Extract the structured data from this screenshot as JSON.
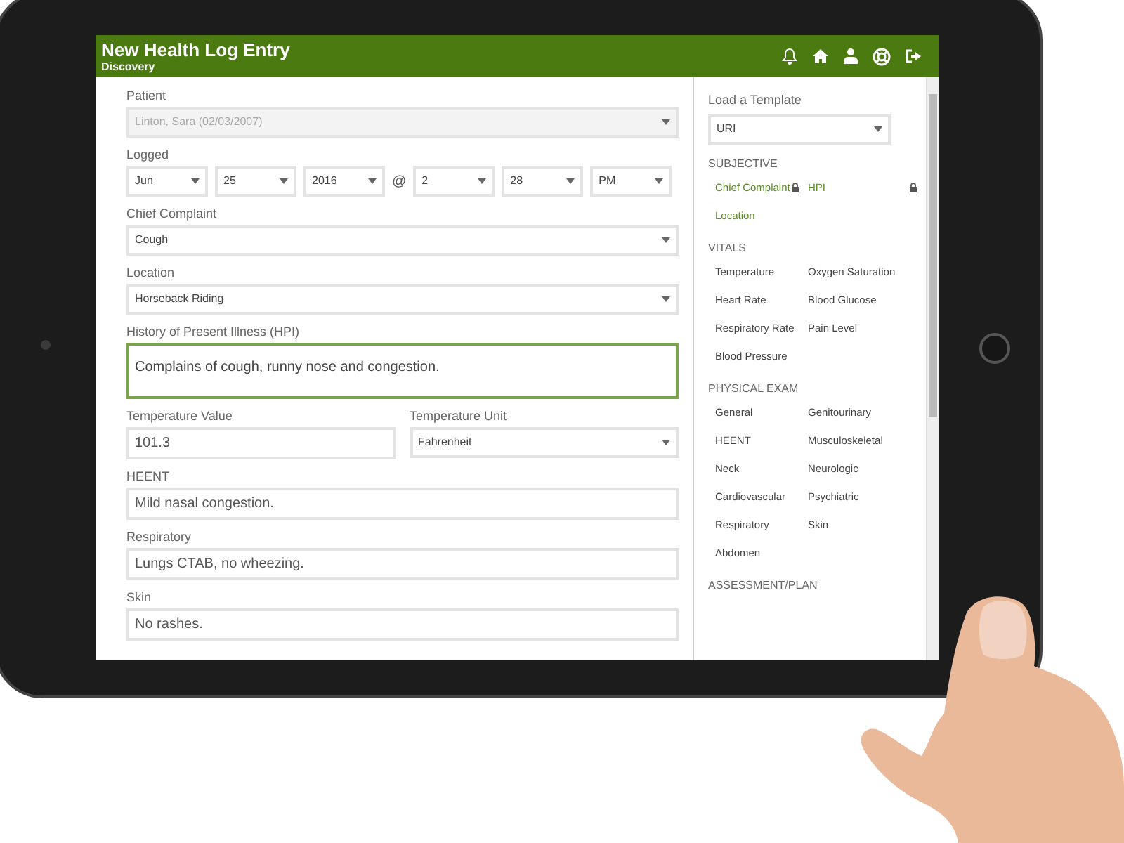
{
  "window": {
    "title": "New Health Log Entry",
    "subtitle": "Discovery"
  },
  "form": {
    "rows": [
      {
        "kind": "single",
        "fields": [
          {
            "label": "Patient",
            "kind": "select",
            "value": "Linton, Sara (02/03/2007)",
            "disabled": true,
            "focused": false
          }
        ]
      },
      {
        "kind": "datetime",
        "label": "Logged",
        "separator": "@",
        "parts": [
          {
            "value": "Jun"
          },
          {
            "value": "25"
          },
          {
            "value": "2016"
          },
          {
            "value": "2"
          },
          {
            "value": "28"
          },
          {
            "value": "PM"
          }
        ]
      },
      {
        "kind": "single",
        "fields": [
          {
            "label": "Chief Complaint",
            "kind": "select",
            "value": "Cough",
            "disabled": false,
            "focused": false
          }
        ]
      },
      {
        "kind": "single",
        "fields": [
          {
            "label": "Location",
            "kind": "select",
            "value": "Horseback Riding",
            "disabled": false,
            "focused": false
          }
        ]
      },
      {
        "kind": "single",
        "fields": [
          {
            "label": "History of Present Illness (HPI)",
            "kind": "textarea",
            "value": "Complains of cough, runny nose and congestion.",
            "disabled": false,
            "focused": true
          }
        ]
      },
      {
        "kind": "single",
        "fields": [
          {
            "label": "Temperature Value",
            "kind": "text",
            "value": "101.3",
            "disabled": false,
            "focused": false
          },
          {
            "label": "Temperature Unit",
            "kind": "select",
            "value": "Fahrenheit",
            "disabled": false,
            "focused": false
          }
        ]
      },
      {
        "kind": "single",
        "fields": [
          {
            "label": "HEENT",
            "kind": "text",
            "value": "Mild nasal congestion.",
            "disabled": false,
            "focused": false
          }
        ]
      },
      {
        "kind": "single",
        "fields": [
          {
            "label": "Respiratory",
            "kind": "text",
            "value": "Lungs CTAB, no wheezing.",
            "disabled": false,
            "focused": false
          }
        ]
      },
      {
        "kind": "single",
        "fields": [
          {
            "label": "Skin",
            "kind": "text",
            "value": "No rashes.",
            "disabled": false,
            "focused": false
          }
        ]
      }
    ]
  },
  "sidebar": {
    "template": {
      "label": "Load a Template",
      "value": "URI"
    },
    "sections": [
      {
        "title": "SUBJECTIVE",
        "items": [
          {
            "label": "Chief Complaint",
            "selected": true,
            "locked": true
          },
          {
            "label": "HPI",
            "selected": true,
            "locked": true
          },
          {
            "label": "Location",
            "selected": true,
            "locked": false
          }
        ]
      },
      {
        "title": "VITALS",
        "items": [
          {
            "label": "Temperature",
            "selected": false,
            "locked": false
          },
          {
            "label": "Oxygen Saturation",
            "selected": false,
            "locked": false
          },
          {
            "label": "Heart Rate",
            "selected": false,
            "locked": false
          },
          {
            "label": "Blood Glucose",
            "selected": false,
            "locked": false
          },
          {
            "label": "Respiratory Rate",
            "selected": false,
            "locked": false
          },
          {
            "label": "Pain Level",
            "selected": false,
            "locked": false
          },
          {
            "label": "Blood Pressure",
            "selected": false,
            "locked": false
          }
        ]
      },
      {
        "title": "PHYSICAL EXAM",
        "items": [
          {
            "label": "General",
            "selected": false,
            "locked": false
          },
          {
            "label": "Genitourinary",
            "selected": false,
            "locked": false
          },
          {
            "label": "HEENT",
            "selected": false,
            "locked": false
          },
          {
            "label": "Musculoskeletal",
            "selected": false,
            "locked": false
          },
          {
            "label": "Neck",
            "selected": false,
            "locked": false
          },
          {
            "label": "Neurologic",
            "selected": false,
            "locked": false
          },
          {
            "label": "Cardiovascular",
            "selected": false,
            "locked": false
          },
          {
            "label": "Psychiatric",
            "selected": false,
            "locked": false
          },
          {
            "label": "Respiratory",
            "selected": false,
            "locked": false
          },
          {
            "label": "Skin",
            "selected": false,
            "locked": false
          },
          {
            "label": "Abdomen",
            "selected": false,
            "locked": false
          }
        ]
      },
      {
        "title": "ASSESSMENT/PLAN"
      }
    ]
  }
}
